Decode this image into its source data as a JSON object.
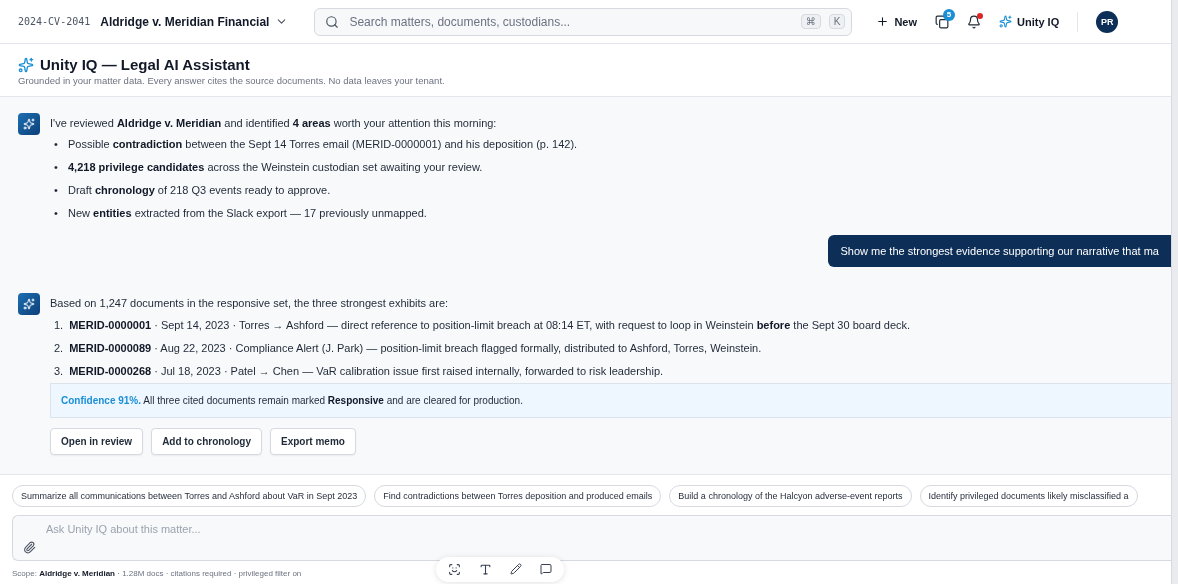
{
  "header": {
    "case_number": "2024-CV-2041",
    "matter_title": "Aldridge v. Meridian Financial",
    "search": {
      "placeholder": "Search matters, documents, custodians..."
    },
    "shortcut_keys": [
      "⌘",
      "K"
    ],
    "new_button": "New",
    "documents_badge": "5",
    "notifications": {
      "unread": true
    },
    "assistant_button": "Unity IQ",
    "avatar": "PR"
  },
  "assistant": {
    "title": "Unity IQ — Legal AI Assistant",
    "subtitle": "Grounded in your matter data. Every answer cites the source documents. No data leaves your tenant."
  },
  "messages": [
    {
      "kind": "assistant",
      "intro": "I've reviewed **Aldridge v. Meridian** and identified **4 areas** worth your attention this morning:",
      "items": [
        {
          "marker": "•",
          "text": "Possible **contradiction** between the Sept 14 Torres email (MERID-0000001) and his deposition (p. 142)."
        },
        {
          "marker": "•",
          "text": "**4,218 privilege candidates** across the Weinstein custodian set awaiting your review."
        },
        {
          "marker": "•",
          "text": "Draft **chronology** of 218 Q3 events ready to approve."
        },
        {
          "marker": "•",
          "text": "New **entities** extracted from the Slack export — 17 previously unmapped."
        }
      ]
    },
    {
      "kind": "user",
      "text": "Show me the strongest evidence supporting our narrative that ma"
    },
    {
      "kind": "assistant",
      "intro": "Based on 1,247 documents in the responsive set, the three strongest exhibits are:",
      "items": [
        {
          "marker": "1.",
          "text": "**MERID-0000001** · Sept 14, 2023 · Torres → Ashford — direct reference to position-limit breach at 08:14 ET, with request to loop in Weinstein **before** the Sept 30 board deck."
        },
        {
          "marker": "2.",
          "text": "**MERID-0000089** · Aug 22, 2023 · Compliance Alert (J. Park) — position-limit breach flagged formally, distributed to Ashford, Torres, Weinstein."
        },
        {
          "marker": "3.",
          "text": "**MERID-0000268** · Jul 18, 2023 · Patel → Chen — VaR calibration issue first raised internally, forwarded to risk leadership."
        }
      ],
      "callout": {
        "lead": "Confidence 91%.",
        "text": "All three cited documents remain marked **Responsive** and are cleared for production."
      },
      "actions": [
        "Open in review",
        "Add to chronology",
        "Export memo"
      ]
    }
  ],
  "suggestions": [
    "Summarize all communications between Torres and Ashford about VaR in Sept 2023",
    "Find contradictions between Torres deposition and produced emails",
    "Build a chronology of the Halcyon adverse-event reports",
    "Identify privileged documents likely misclassified a"
  ],
  "composer": {
    "placeholder": "Ask Unity IQ about this matter..."
  },
  "scope": "Scope: **Aldridge v. Meridian** · 1.28M docs · citations required · privileged filter on"
}
